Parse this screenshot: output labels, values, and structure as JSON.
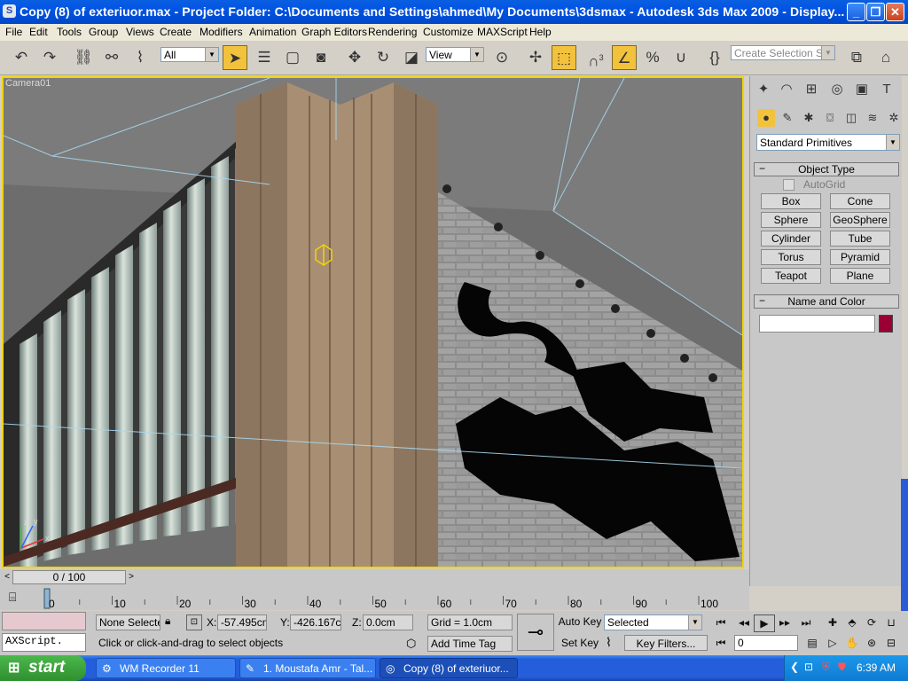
{
  "window": {
    "title": "Copy (8) of exteriuor.max     - Project Folder: C:\\Documents and Settings\\ahmed\\My Documents\\3dsmax     - Autodesk 3ds Max  2009     - Display...",
    "controls": [
      "minimize-icon",
      "restore-icon",
      "close-icon"
    ]
  },
  "menu": [
    "File",
    "Edit",
    "Tools",
    "Group",
    "Views",
    "Create",
    "Modifiers",
    "Animation",
    "Graph Editors",
    "Rendering",
    "Customize",
    "MAXScript",
    "Help"
  ],
  "toolbar": {
    "selection_filter": "All",
    "reference_coord": "View",
    "snap_label": "3",
    "named_selection_placeholder": "Create Selection Set"
  },
  "viewport": {
    "label": "Camera01",
    "signage_text": "سكندر",
    "axis_labels": [
      "x",
      "y",
      "z"
    ]
  },
  "command_panel": {
    "category": "Standard Primitives",
    "object_type_title": "Object Type",
    "autogrid_label": "AutoGrid",
    "autogrid_checked": false,
    "primitives": [
      "Box",
      "Cone",
      "Sphere",
      "GeoSphere",
      "Cylinder",
      "Tube",
      "Torus",
      "Pyramid",
      "Teapot",
      "Plane"
    ],
    "name_color_title": "Name and Color",
    "name_value": "",
    "object_color": "#990033"
  },
  "timeline": {
    "frame_display": "0 / 100",
    "current_frame": 0,
    "total_frames": 100,
    "ticks": [
      "0",
      "10",
      "20",
      "30",
      "40",
      "50",
      "60",
      "70",
      "80",
      "90",
      "100"
    ]
  },
  "status": {
    "maxscript_label": "AXScript.",
    "selection_status": "None Selecte",
    "x_label": "X:",
    "x_value": "-57.495cm",
    "y_label": "Y:",
    "y_value": "-426.167cm",
    "z_label": "Z:",
    "z_value": "0.0cm",
    "grid": "Grid = 1.0cm",
    "prompt": "Click or click-and-drag to select objects",
    "add_time_tag": "Add Time Tag",
    "auto_key": "Auto Key",
    "set_key": "Set Key",
    "key_mode": "Selected",
    "key_filters": "Key Filters...",
    "frame_spinner": "0"
  },
  "taskbar": {
    "start_label": "start",
    "tasks": [
      "WM Recorder 11",
      "1. Moustafa Amr - Tal...",
      "Copy (8) of exteriuor..."
    ],
    "clock": "6:39 AM"
  }
}
